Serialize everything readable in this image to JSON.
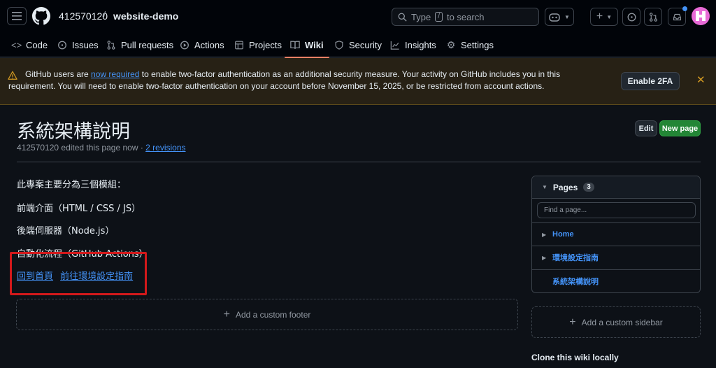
{
  "header": {
    "owner": "412570120",
    "separator": "/",
    "repo": "website-demo",
    "search": {
      "prefix": "Type",
      "key": "/",
      "suffix": "to search"
    }
  },
  "repo_nav": {
    "tabs": [
      {
        "label": "Code",
        "icon": "code-icon"
      },
      {
        "label": "Issues",
        "icon": "issue-icon"
      },
      {
        "label": "Pull requests",
        "icon": "pull-request-icon"
      },
      {
        "label": "Actions",
        "icon": "play-icon"
      },
      {
        "label": "Projects",
        "icon": "table-icon"
      },
      {
        "label": "Wiki",
        "icon": "book-icon",
        "active": true
      },
      {
        "label": "Security",
        "icon": "shield-icon"
      },
      {
        "label": "Insights",
        "icon": "graph-icon"
      },
      {
        "label": "Settings",
        "icon": "gear-icon"
      }
    ]
  },
  "banner": {
    "text_before": "GitHub users are ",
    "link": "now required",
    "text_after": " to enable two-factor authentication as an additional security measure. Your activity on GitHub includes you in this requirement. You will need to enable two-factor authentication on your account before November 15, 2025, or be restricted from account actions.",
    "button": "Enable 2FA",
    "close": "✕"
  },
  "page": {
    "title": "系統架構說明",
    "meta_text": "412570120 edited this page now · ",
    "revisions": "2 revisions",
    "edit": "Edit",
    "new_page": "New page"
  },
  "content": {
    "p1": "此專案主要分為三個模組：",
    "p2": "前端介面（HTML / CSS / JS）",
    "p3": "後端伺服器（Node.js）",
    "p4": "自動化流程（GitHub Actions）",
    "link1": "回到首頁",
    "link2": "前往環境設定指南"
  },
  "footer_box": {
    "label": "Add a custom footer"
  },
  "sidebar": {
    "pages_label": "Pages",
    "pages_count": "3",
    "find_placeholder": "Find a page...",
    "items": [
      "Home",
      "環境設定指南",
      "系統架構說明"
    ],
    "custom_sidebar": "Add a custom sidebar",
    "clone": "Clone this wiki locally"
  },
  "colors": {
    "accent": "#4493f8",
    "active_tab": "#f78166",
    "warning": "#d29922",
    "new_button": "#238636",
    "highlight_box": "#d2191b"
  }
}
